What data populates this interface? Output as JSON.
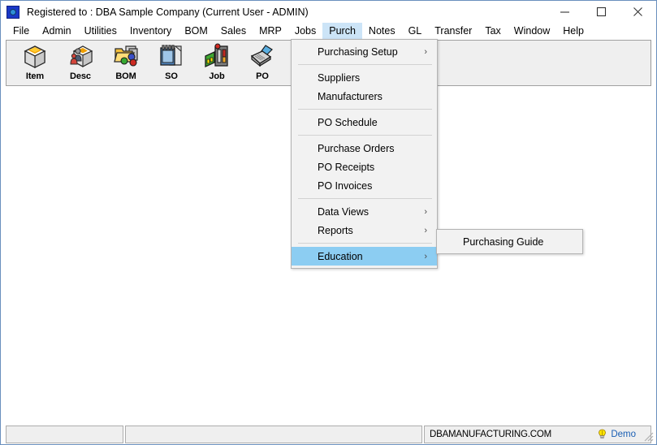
{
  "window": {
    "title": "Registered to : DBA Sample Company (Current User - ADMIN)",
    "app_icon": "dba-app-icon",
    "controls": {
      "minimize": "minimize-icon",
      "maximize": "maximize-icon",
      "close": "close-icon"
    }
  },
  "menubar": {
    "items": [
      {
        "label": "File",
        "active": false
      },
      {
        "label": "Admin",
        "active": false
      },
      {
        "label": "Utilities",
        "active": false
      },
      {
        "label": "Inventory",
        "active": false
      },
      {
        "label": "BOM",
        "active": false
      },
      {
        "label": "Sales",
        "active": false
      },
      {
        "label": "MRP",
        "active": false
      },
      {
        "label": "Jobs",
        "active": false
      },
      {
        "label": "Purch",
        "active": true
      },
      {
        "label": "Notes",
        "active": false
      },
      {
        "label": "GL",
        "active": false
      },
      {
        "label": "Transfer",
        "active": false
      },
      {
        "label": "Tax",
        "active": false
      },
      {
        "label": "Window",
        "active": false
      },
      {
        "label": "Help",
        "active": false
      }
    ]
  },
  "toolbar": {
    "buttons": [
      {
        "label": "Item",
        "icon": "item-box-icon"
      },
      {
        "label": "Desc",
        "icon": "descriptor-people-box-icon"
      },
      {
        "label": "BOM",
        "icon": "bom-folder-icon"
      },
      {
        "label": "SO",
        "icon": "sales-order-notepad-icon"
      },
      {
        "label": "Job",
        "icon": "job-machine-icon"
      },
      {
        "label": "PO",
        "icon": "purchase-order-stapler-icon"
      }
    ]
  },
  "purch_menu": {
    "entries": [
      {
        "type": "item",
        "label": "Purchasing Setup",
        "submenu": true,
        "highlight": false
      },
      {
        "type": "separator"
      },
      {
        "type": "item",
        "label": "Suppliers",
        "submenu": false,
        "highlight": false
      },
      {
        "type": "item",
        "label": "Manufacturers",
        "submenu": false,
        "highlight": false
      },
      {
        "type": "separator"
      },
      {
        "type": "item",
        "label": "PO Schedule",
        "submenu": false,
        "highlight": false
      },
      {
        "type": "separator"
      },
      {
        "type": "item",
        "label": "Purchase Orders",
        "submenu": false,
        "highlight": false
      },
      {
        "type": "item",
        "label": "PO Receipts",
        "submenu": false,
        "highlight": false
      },
      {
        "type": "item",
        "label": "PO Invoices",
        "submenu": false,
        "highlight": false
      },
      {
        "type": "separator"
      },
      {
        "type": "item",
        "label": "Data Views",
        "submenu": true,
        "highlight": false
      },
      {
        "type": "item",
        "label": "Reports",
        "submenu": true,
        "highlight": false
      },
      {
        "type": "separator"
      },
      {
        "type": "item",
        "label": "Education",
        "submenu": true,
        "highlight": true
      }
    ],
    "arrow_glyph": "›"
  },
  "education_submenu": {
    "entries": [
      {
        "type": "item",
        "label": "Purchasing Guide",
        "submenu": false,
        "highlight": false
      }
    ]
  },
  "statusbar": {
    "panel1": "",
    "panel2": "",
    "site": "DBAMANUFACTURING.COM",
    "demo_label": "Demo",
    "demo_icon": "lightbulb-icon",
    "grip": "resize-grip-icon"
  },
  "colors": {
    "menu_highlight": "#8ccdf2",
    "menubar_active": "#cce4f7",
    "window_border": "#6a90bd",
    "panel_bg": "#efefef",
    "menu_bg": "#f2f2f2",
    "demo_text": "#1a5fb4",
    "bulb": "#ffe400"
  }
}
